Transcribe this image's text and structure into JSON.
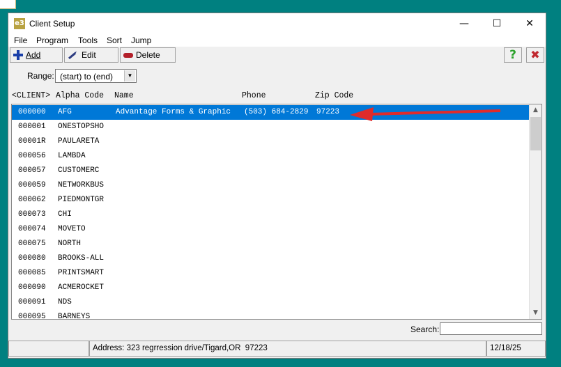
{
  "window": {
    "title": "Client Setup",
    "icon_label": "e3",
    "controls": {
      "minimize": "—",
      "maximize": "☐",
      "close": "✕"
    }
  },
  "menu": [
    "File",
    "Program",
    "Tools",
    "Sort",
    "Jump"
  ],
  "toolbar": {
    "add_label": "Add",
    "edit_label": "Edit",
    "delete_label": "Delete",
    "help_label": "?",
    "exit_label": "✖"
  },
  "range": {
    "label": "Range:",
    "value": "(start) to (end)"
  },
  "columns": {
    "client": "<CLIENT>",
    "alpha_code": "Alpha Code",
    "name": "Name",
    "phone": "Phone",
    "zip_code": "Zip Code"
  },
  "rows": [
    {
      "client": "000000",
      "alpha": "AFG",
      "name": "Advantage Forms & Graphic",
      "phone": "(503) 684-2829",
      "zip": "97223",
      "selected": true
    },
    {
      "client": "000001",
      "alpha": "ONESTOPSHO",
      "name": "",
      "phone": "",
      "zip": ""
    },
    {
      "client": "00001R",
      "alpha": "PAULARETA",
      "name": "",
      "phone": "",
      "zip": ""
    },
    {
      "client": "000056",
      "alpha": "LAMBDA",
      "name": "",
      "phone": "",
      "zip": ""
    },
    {
      "client": "000057",
      "alpha": "CUSTOMERC",
      "name": "",
      "phone": "",
      "zip": ""
    },
    {
      "client": "000059",
      "alpha": "NETWORKBUS",
      "name": "",
      "phone": "",
      "zip": ""
    },
    {
      "client": "000062",
      "alpha": "PIEDMONTGR",
      "name": "",
      "phone": "",
      "zip": ""
    },
    {
      "client": "000073",
      "alpha": "CHI",
      "name": "",
      "phone": "",
      "zip": ""
    },
    {
      "client": "000074",
      "alpha": "MOVETO",
      "name": "",
      "phone": "",
      "zip": ""
    },
    {
      "client": "000075",
      "alpha": "NORTH",
      "name": "",
      "phone": "",
      "zip": ""
    },
    {
      "client": "000080",
      "alpha": "BROOKS-ALL",
      "name": "",
      "phone": "",
      "zip": ""
    },
    {
      "client": "000085",
      "alpha": "PRINTSMART",
      "name": "",
      "phone": "",
      "zip": ""
    },
    {
      "client": "000090",
      "alpha": "ACMEROCKET",
      "name": "",
      "phone": "",
      "zip": ""
    },
    {
      "client": "000091",
      "alpha": "NDS",
      "name": "",
      "phone": "",
      "zip": ""
    },
    {
      "client": "000095",
      "alpha": "BARNEYS",
      "name": "",
      "phone": "",
      "zip": ""
    }
  ],
  "search": {
    "label": "Search:",
    "value": ""
  },
  "status": {
    "left": "",
    "address": "Address: 323 regrression drive/Tigard,OR  97223",
    "date": "12/18/25"
  },
  "colors": {
    "desktop": "#008080",
    "selection": "#0078d7",
    "annotation_arrow": "#e02b2b",
    "help": "#2aa12a",
    "exit": "#c0282f"
  },
  "icons": [
    "app-icon",
    "plus-icon",
    "pencil-icon",
    "eraser-icon",
    "help-icon",
    "exit-icon",
    "chevron-down-icon",
    "scroll-up-icon",
    "scroll-down-icon",
    "red-arrow-annotation"
  ]
}
